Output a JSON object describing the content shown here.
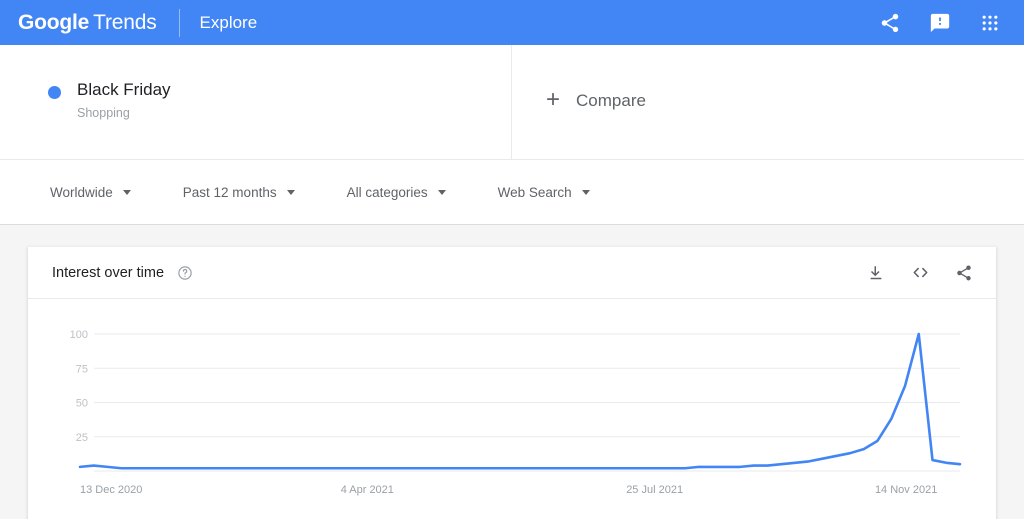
{
  "appbar": {
    "logo_bold": "Google",
    "logo_light": "Trends",
    "explore": "Explore",
    "icons": [
      {
        "name": "share-icon",
        "label": "Share"
      },
      {
        "name": "feedback-icon",
        "label": "Send feedback"
      },
      {
        "name": "apps-grid-icon",
        "label": "Google apps"
      }
    ]
  },
  "search_terms": [
    {
      "title": "Black Friday",
      "subtitle": "Shopping",
      "color": "#4285f4"
    }
  ],
  "compare": {
    "plus": "+",
    "label": "Compare"
  },
  "filters": [
    {
      "name": "location",
      "label": "Worldwide"
    },
    {
      "name": "time-range",
      "label": "Past 12 months"
    },
    {
      "name": "category",
      "label": "All categories"
    },
    {
      "name": "search-type",
      "label": "Web Search"
    }
  ],
  "card": {
    "title": "Interest over time",
    "help": "?",
    "actions": [
      {
        "name": "download-csv-icon",
        "label": "Download"
      },
      {
        "name": "embed-code-icon",
        "label": "Embed"
      },
      {
        "name": "share-icon",
        "label": "Share"
      }
    ]
  },
  "chart_data": {
    "type": "line",
    "title": "Interest over time",
    "xlabel": "",
    "ylabel": "",
    "ylim": [
      0,
      100
    ],
    "grid": true,
    "legend": false,
    "line_color": "#4285f4",
    "y_ticks": [
      100,
      75,
      50,
      25
    ],
    "x_ticks": [
      "13 Dec 2020",
      "4 Apr 2021",
      "25 Jul 2021",
      "14 Nov 2021"
    ],
    "x_tick_positions": [
      0,
      0.3265,
      0.653,
      0.9388
    ],
    "series": [
      {
        "name": "Black Friday",
        "values": [
          3,
          4,
          3,
          2,
          2,
          2,
          2,
          2,
          2,
          2,
          2,
          2,
          2,
          2,
          2,
          2,
          2,
          2,
          2,
          2,
          2,
          2,
          2,
          2,
          2,
          2,
          2,
          2,
          2,
          2,
          2,
          2,
          2,
          2,
          2,
          2,
          2,
          2,
          2,
          2,
          2,
          2,
          2,
          2,
          2,
          3,
          3,
          3,
          3,
          4,
          4,
          5,
          6,
          7,
          9,
          11,
          13,
          16,
          22,
          38,
          62,
          100,
          8,
          6,
          5
        ]
      }
    ]
  }
}
